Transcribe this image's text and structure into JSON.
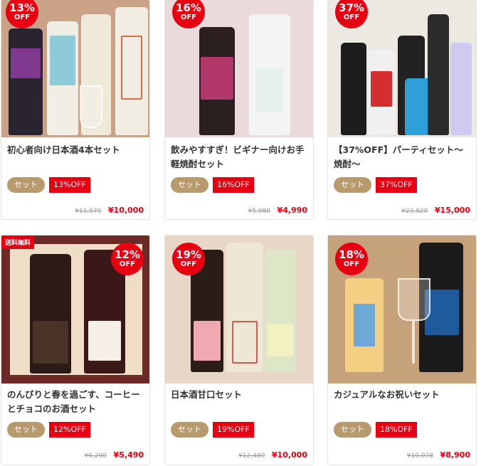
{
  "products": [
    {
      "title": "初心者向け日本酒4本セット",
      "tag": "セット",
      "off": "13%OFF",
      "old_price": "¥11,570",
      "price": "¥10,000",
      "badge_pct": "13%",
      "badge_off": "OFF",
      "bg": "#cfa58c"
    },
    {
      "title": "飲みやすすぎ！ビギナー向けお手軽焼酎セット",
      "tag": "セット",
      "off": "16%OFF",
      "old_price": "¥5,980",
      "price": "¥4,990",
      "badge_pct": "16%",
      "badge_off": "OFF",
      "bg": "#eadcdc"
    },
    {
      "title": "【37%OFF】パーティセット〜焼酎〜",
      "tag": "セット",
      "off": "37%OFF",
      "old_price": "¥23,820",
      "price": "¥15,000",
      "badge_pct": "37%",
      "badge_off": "OFF",
      "bg": "#ece8e2"
    },
    {
      "title": "のんびりと春を過ごす、コーヒーとチョコのお酒セット",
      "tag": "セット",
      "off": "12%OFF",
      "old_price": "¥6,290",
      "price": "¥5,490",
      "badge_pct": "12%",
      "badge_off": "OFF",
      "ship": "送料無料",
      "bg": "#6b2a25"
    },
    {
      "title": "日本酒甘口セット",
      "tag": "セット",
      "off": "19%OFF",
      "old_price": "¥12,480",
      "price": "¥10,000",
      "badge_pct": "19%",
      "badge_off": "OFF",
      "bg": "#e7d6c6"
    },
    {
      "title": "カジュアルなお祝いセット",
      "tag": "セット",
      "off": "18%OFF",
      "old_price": "¥10,978",
      "price": "¥8,900",
      "badge_pct": "18%",
      "badge_off": "OFF",
      "bg": "#c7a27a"
    }
  ]
}
